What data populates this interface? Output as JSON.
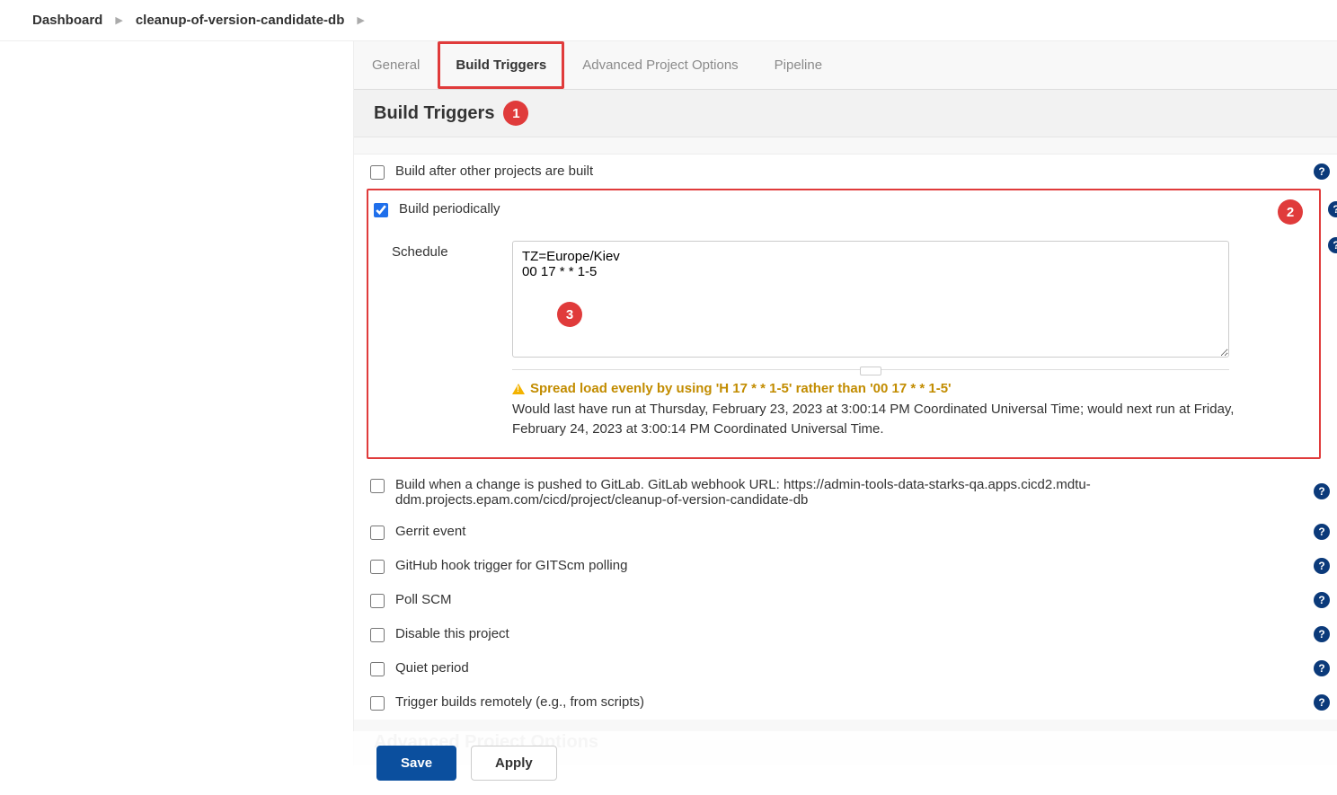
{
  "breadcrumbs": {
    "root": "Dashboard",
    "project": "cleanup-of-version-candidate-db"
  },
  "tabs": {
    "general": "General",
    "build_triggers": "Build Triggers",
    "advanced": "Advanced Project Options",
    "pipeline": "Pipeline"
  },
  "section": {
    "title": "Build Triggers",
    "advanced_title": "Advanced Project Options"
  },
  "options": {
    "build_after": "Build after other projects are built",
    "build_periodically": "Build periodically",
    "schedule_label": "Schedule",
    "schedule_value": "TZ=Europe/Kiev\n00 17 * * 1-5",
    "warn_text": "Spread load evenly by using 'H 17 * * 1-5' rather than '00 17 * * 1-5'",
    "desc_text": "Would last have run at Thursday, February 23, 2023 at 3:00:14 PM Coordinated Universal Time; would next run at Friday, February 24, 2023 at 3:00:14 PM Coordinated Universal Time.",
    "gitlab_push": "Build when a change is pushed to GitLab. GitLab webhook URL: https://admin-tools-data-starks-qa.apps.cicd2.mdtu-ddm.projects.epam.com/cicd/project/cleanup-of-version-candidate-db",
    "gerrit": "Gerrit event",
    "github_hook": "GitHub hook trigger for GITScm polling",
    "poll_scm": "Poll SCM",
    "disable": "Disable this project",
    "quiet": "Quiet period",
    "remote": "Trigger builds remotely (e.g., from scripts)"
  },
  "callouts": {
    "c1": "1",
    "c2": "2",
    "c3": "3"
  },
  "buttons": {
    "save": "Save",
    "apply": "Apply"
  },
  "help": "?"
}
